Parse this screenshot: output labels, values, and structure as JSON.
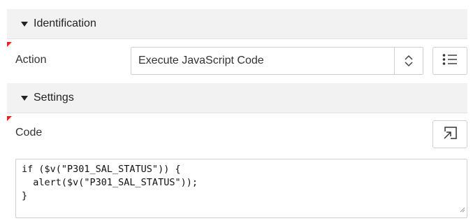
{
  "sections": {
    "identification": "Identification",
    "settings": "Settings"
  },
  "action": {
    "label": "Action",
    "value": "Execute JavaScript Code"
  },
  "code": {
    "label": "Code",
    "lines": [
      "if ($v(\"P301_SAL_STATUS\")) {",
      "  alert($v(\"P301_SAL_STATUS\"));",
      "}"
    ]
  },
  "icons": {
    "stepper": "up-down-chevron-icon",
    "list": "list-icon",
    "expand": "expand-editor-icon",
    "resize": "resize-grip-icon"
  },
  "colors": {
    "header_bg": "#f2f2f2",
    "required_marker": "#e0281a",
    "border": "#cfcfcf"
  }
}
